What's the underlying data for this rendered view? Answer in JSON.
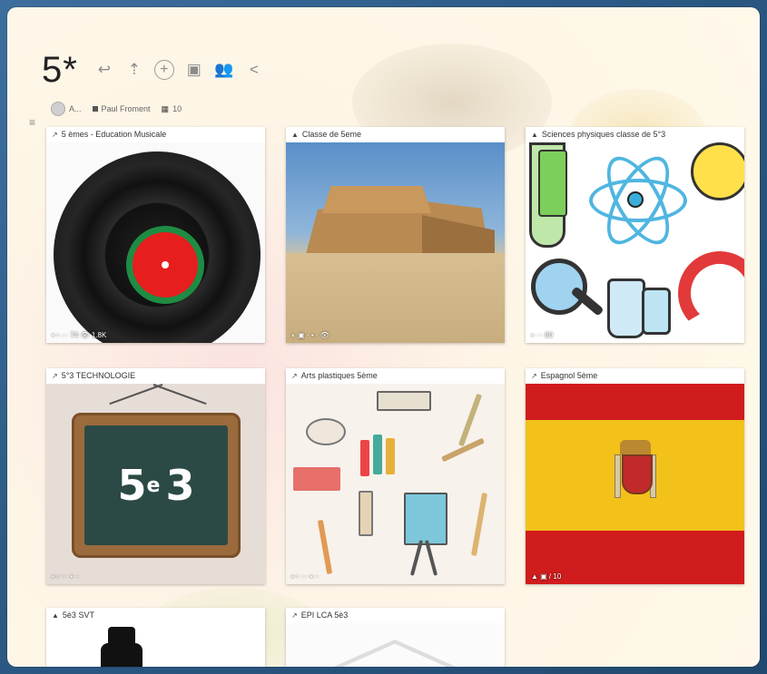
{
  "board": {
    "title": "5*",
    "toolbar": [
      {
        "icon": "back-arrow-icon",
        "glyph": "↩"
      },
      {
        "icon": "upload-icon",
        "glyph": "⇡"
      },
      {
        "icon": "add-icon",
        "glyph": "+"
      },
      {
        "icon": "collect-icon",
        "glyph": "▣"
      },
      {
        "icon": "people-icon",
        "glyph": "👥"
      },
      {
        "icon": "share-icon",
        "glyph": "<"
      }
    ],
    "meta": {
      "owner_short": "A...",
      "author": "Paul Froment",
      "count": "10"
    }
  },
  "cards": [
    {
      "title": "5 èmes - Education Musicale",
      "head_icon": "share-icon",
      "head_glyph": "↗",
      "stats": "▪ ▫ ··· 74 👁 1.8K"
    },
    {
      "title": "Classe de 5eme",
      "head_icon": "lock-icon",
      "head_glyph": "▲",
      "stats": "◐ ▣ · ▪ · 👁"
    },
    {
      "title": "Sciences physiques classe de 5°3",
      "head_icon": "lock-icon",
      "head_glyph": "▲",
      "stats": "▪ ··· 80"
    },
    {
      "title": "5°3 TECHNOLOGIE",
      "head_icon": "share-icon",
      "head_glyph": "↗",
      "stats": "▪ ▫ ··· ▪ ··"
    },
    {
      "title": "Arts plastiques 5ème",
      "head_icon": "share-icon",
      "head_glyph": "↗",
      "stats": "▪ ▫ ··· ▪ ··"
    },
    {
      "title": "Espagnol 5ème",
      "head_icon": "share-icon",
      "head_glyph": "↗",
      "stats": "▲ ▣ / 10"
    },
    {
      "title": "5è3 SVT",
      "head_icon": "lock-icon",
      "head_glyph": "▲",
      "stats": ""
    },
    {
      "title": "EPI LCA 5è3",
      "head_icon": "share-icon",
      "head_glyph": "↗",
      "stats": ""
    }
  ],
  "chalkboard": {
    "main": "5",
    "sup": "e",
    "tail": "3"
  },
  "colors": {
    "accent_red": "#d01c1c",
    "accent_yellow": "#f2c21b",
    "board_green": "#2c4a45"
  }
}
